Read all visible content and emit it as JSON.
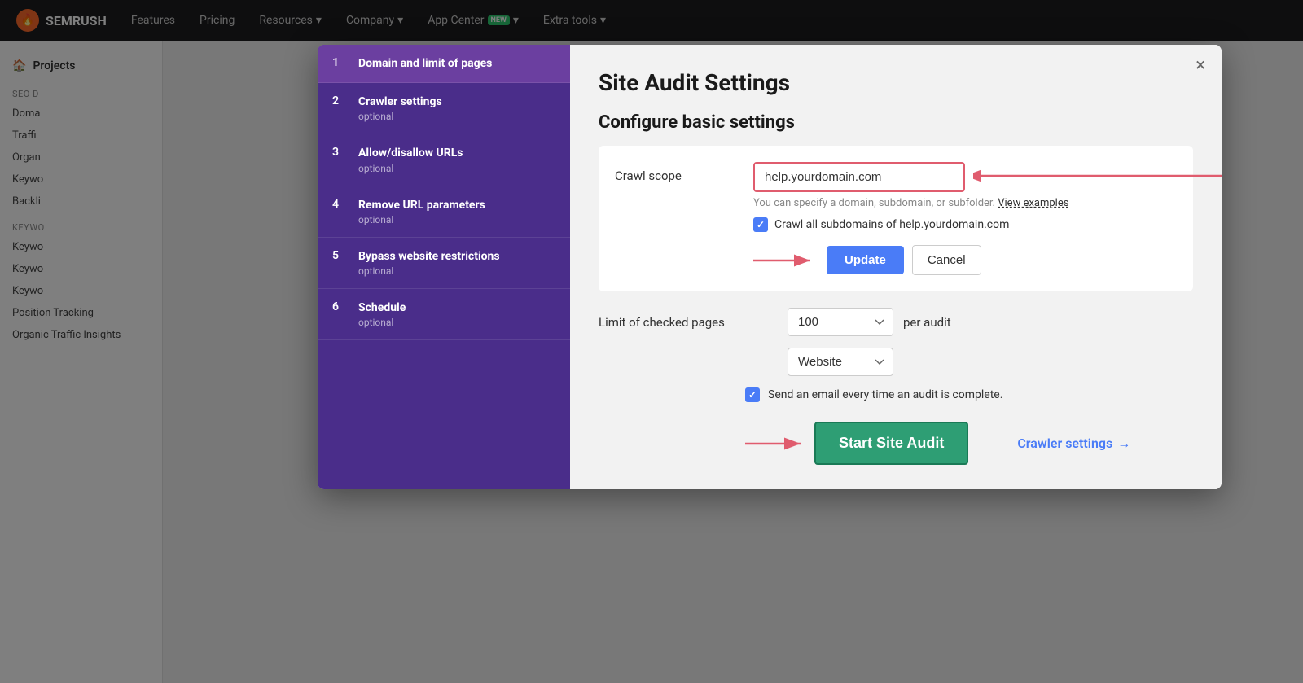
{
  "topnav": {
    "logo_text": "SEMRUSH",
    "nav_items": [
      {
        "label": "Features",
        "has_dropdown": false
      },
      {
        "label": "Pricing",
        "has_dropdown": false
      },
      {
        "label": "Resources",
        "has_dropdown": true
      },
      {
        "label": "Company",
        "has_dropdown": true
      },
      {
        "label": "App Center",
        "has_dropdown": true,
        "badge": "NEW"
      },
      {
        "label": "Extra tools",
        "has_dropdown": true
      }
    ]
  },
  "sidebar": {
    "home_label": "Projects",
    "sections": [
      {
        "title": "SEO D",
        "links": [
          "Doma",
          "Traffi",
          "Organ",
          "Keywo",
          "Backli"
        ]
      },
      {
        "title": "KEYWO",
        "links": [
          "Keywo",
          "Keywo",
          "Keywo",
          "Position Tracking",
          "Organic Traffic Insights"
        ]
      }
    ]
  },
  "modal": {
    "title": "Site Audit Settings",
    "close_label": "×",
    "sidebar_items": [
      {
        "num": "1",
        "title": "Domain and limit of pages",
        "sub": "",
        "active": true
      },
      {
        "num": "2",
        "title": "Crawler settings",
        "sub": "optional",
        "active": false
      },
      {
        "num": "3",
        "title": "Allow/disallow URLs",
        "sub": "optional",
        "active": false
      },
      {
        "num": "4",
        "title": "Remove URL parameters",
        "sub": "optional",
        "active": false
      },
      {
        "num": "5",
        "title": "Bypass website restrictions",
        "sub": "optional",
        "active": false
      },
      {
        "num": "6",
        "title": "Schedule",
        "sub": "optional",
        "active": false
      }
    ],
    "section_title": "Configure basic settings",
    "crawl_scope_label": "Crawl scope",
    "crawl_scope_value": "help.yourdomain.com",
    "crawl_scope_hint": "You can specify a domain, subdomain, or subfolder.",
    "crawl_scope_hint_link": "View examples",
    "checkbox_label": "Crawl all subdomains of help.yourdomain.com",
    "btn_update": "Update",
    "btn_cancel": "Cancel",
    "limit_label": "Limit of checked pages",
    "limit_value": "100",
    "per_audit": "per audit",
    "website_value": "Website",
    "email_label": "Send an email every time an audit is complete.",
    "btn_start_audit": "Start Site Audit",
    "crawler_settings_link": "Crawler settings",
    "crawler_settings_arrow": "→"
  }
}
